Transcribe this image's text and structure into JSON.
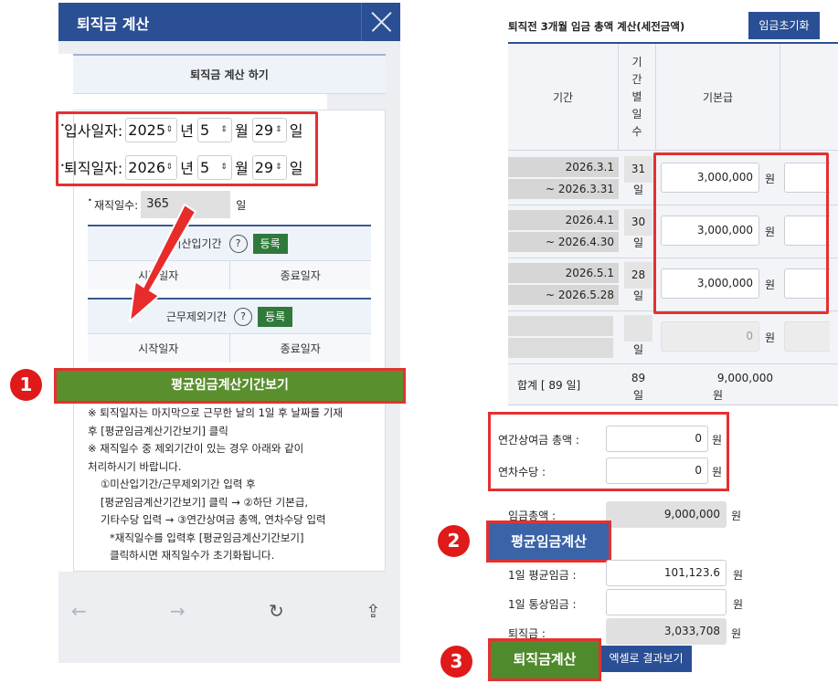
{
  "left": {
    "header_title": "퇴직금 계산",
    "subtitle": "퇴직금 계산 하기",
    "hire": {
      "label": "입사일자:",
      "year": "2025",
      "month": "5",
      "day": "29"
    },
    "retire": {
      "label": "퇴직일자:",
      "year": "2026",
      "month": "5",
      "day": "29"
    },
    "units": {
      "year": "년",
      "month": "월",
      "day": "일"
    },
    "work_days": {
      "label": "재직일수:",
      "value": "365",
      "unit": "일"
    },
    "unpaid_period": {
      "label": "미산입기간",
      "help": "?",
      "register": "등록",
      "start": "시작일자",
      "end": "종료일자"
    },
    "excluded_period": {
      "label": "근무제외기간",
      "help": "?",
      "register": "등록",
      "start": "시작일자",
      "end": "종료일자"
    },
    "avg_period_button": "평균임금계산기간보기",
    "notes": [
      "※ 퇴직일자는 마지막으로 근무한 날의 1일 후 날짜를 기재",
      "후 [평균임금계산기간보기] 클릭",
      "※ 재직일수 중 제외기간이 있는 경우 아래와 같이",
      "처리하시기 바랍니다.",
      "①미산입기간/근무제외기간 입력 후",
      "[평균임금계산기간보기] 클릭 → ②하단 기본급,",
      "기타수당 입력 → ③연간상여금 총액, 연차수당 입력",
      "*재직일수를 입력후 [평균임금계산기간보기]",
      "클릭하시면 재직일수가 초기화됩니다."
    ]
  },
  "badges": [
    "1",
    "2",
    "3"
  ],
  "browser_nav": {
    "back_icon": "←",
    "forward_icon": "→",
    "reload_icon": "↻",
    "share_icon": "⇪"
  },
  "right": {
    "title": "퇴직전 3개월 임금 총액 계산(세전금액)",
    "reset_button": "임금초기화",
    "headers": {
      "period": "기간",
      "days_chars": [
        "기",
        "간",
        "별",
        "일",
        "수"
      ],
      "base_pay": "기본급"
    },
    "rows": [
      {
        "start": "2026.3.1",
        "end": "~ 2026.3.31",
        "days": "31",
        "day_unit": "일",
        "amount": "3,000,000",
        "won": "원"
      },
      {
        "start": "2026.4.1",
        "end": "~ 2026.4.30",
        "days": "30",
        "day_unit": "일",
        "amount": "3,000,000",
        "won": "원"
      },
      {
        "start": "2026.5.1",
        "end": "~ 2026.5.28",
        "days": "28",
        "day_unit": "일",
        "amount": "3,000,000",
        "won": "원"
      },
      {
        "start": "",
        "end": "",
        "days": "",
        "day_unit": "일",
        "amount": "0",
        "won": "원"
      }
    ],
    "total": {
      "label": "합계 [   89  일]",
      "days": "89",
      "day_unit": "일",
      "amount": "9,000,000",
      "won": "원"
    },
    "annual_bonus": {
      "label": "연간상여금 총액 :",
      "value": "0",
      "won": "원"
    },
    "annual_leave": {
      "label": "연차수당 :",
      "value": "0",
      "won": "원"
    },
    "wage_total": {
      "label": "임금총액 :",
      "value": "9,000,000",
      "won": "원"
    },
    "avg_wage_button": "평균임금계산",
    "daily_avg": {
      "label": "1일 평균임금 :",
      "value": "101,123.6",
      "won": "원"
    },
    "daily_ordinary": {
      "label": "1일 통상임금 :",
      "value": "",
      "won": "원"
    },
    "severance": {
      "label": "퇴직금 :",
      "value": "3,033,708",
      "won": "원"
    },
    "severance_button": "퇴직금계산",
    "excel_button": "엑셀로 결과보기"
  },
  "colors": {
    "navy": "#2a4f94",
    "green": "#4f8a2c",
    "red": "#e53030"
  }
}
